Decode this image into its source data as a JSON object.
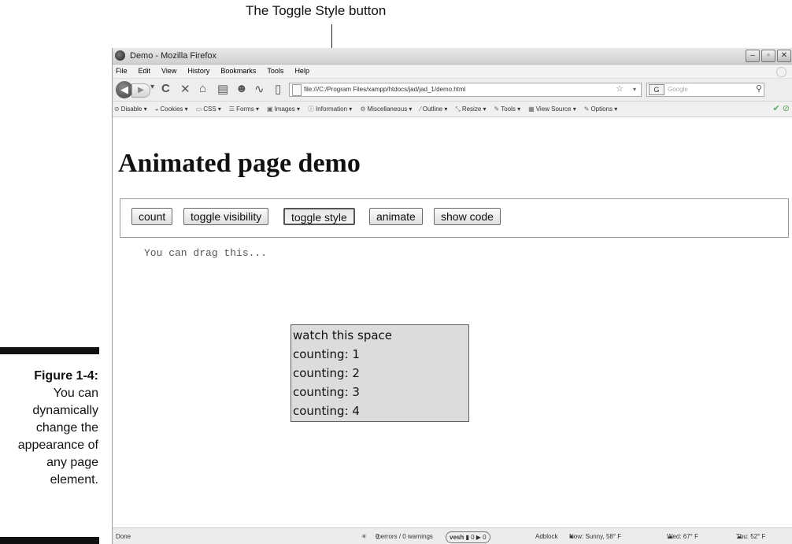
{
  "callout": {
    "label": "The Toggle Style button"
  },
  "figure": {
    "number": "Figure 1-4:",
    "caption": "You can dynamically change the appearance of any page element."
  },
  "browser": {
    "window_title": "Demo - Mozilla Firefox",
    "menu": [
      "File",
      "Edit",
      "View",
      "History",
      "Bookmarks",
      "Tools",
      "Help"
    ],
    "url": "file:///C:/Program Files/xampp/htdocs/jad/jad_1/demo.html",
    "search_placeholder": "Google",
    "search_engine": "G",
    "dev_toolbar": [
      {
        "label": "Disable",
        "icon": "disable-icon"
      },
      {
        "label": "Cookies",
        "icon": "cookies-icon"
      },
      {
        "label": "CSS",
        "icon": "css-icon"
      },
      {
        "label": "Forms",
        "icon": "forms-icon"
      },
      {
        "label": "Images",
        "icon": "images-icon"
      },
      {
        "label": "Information",
        "icon": "information-icon"
      },
      {
        "label": "Miscellaneous",
        "icon": "miscellaneous-icon"
      },
      {
        "label": "Outline",
        "icon": "outline-icon"
      },
      {
        "label": "Resize",
        "icon": "resize-icon"
      },
      {
        "label": "Tools",
        "icon": "tools-icon"
      },
      {
        "label": "View Source",
        "icon": "view-source-icon"
      },
      {
        "label": "Options",
        "icon": "options-icon"
      }
    ],
    "status": {
      "left": "Done",
      "errors": "0 errors / 0 warnings",
      "vesh": "vesh",
      "adblock": "Adblock",
      "now": "Now: Sunny, 58° F",
      "wed": "Wed: 67° F",
      "thu": "Thu: 52° F"
    }
  },
  "page": {
    "title": "Animated page demo",
    "buttons": {
      "count": "count",
      "toggle_visibility": "toggle visibility",
      "toggle_style": "toggle style",
      "animate": "animate",
      "show_code": "show code"
    },
    "drag_text": "You can drag this...",
    "watch_lines": [
      "watch this space",
      "counting: 1",
      "counting: 2",
      "counting: 3",
      "counting: 4"
    ]
  }
}
